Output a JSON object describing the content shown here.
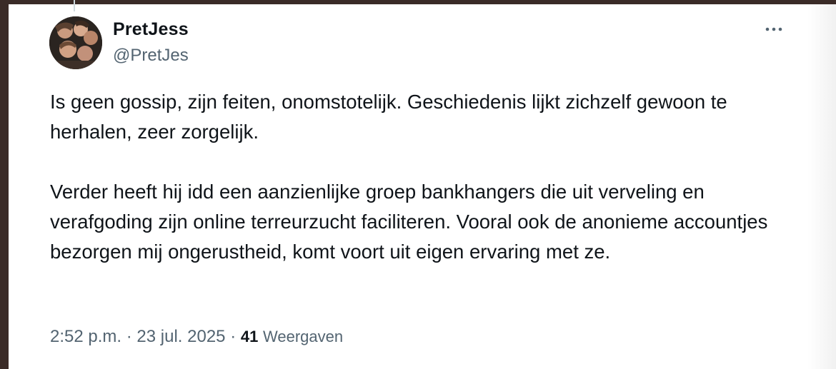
{
  "tweet": {
    "author_name": "PretJess",
    "author_handle": "@PretJes",
    "paragraphs": [
      "Is geen gossip, zijn feiten, onomstotelijk. Geschiedenis lijkt zichzelf gewoon te herhalen, zeer zorgelijk.",
      "Verder heeft hij idd een aanzienlijke groep bankhangers die uit verveling en verafgoding zijn online terreurzucht faciliteren. Vooral ook de anonieme accountjes bezorgen mij ongerustheid, komt voort uit eigen ervaring met ze."
    ],
    "time": "2:52 p.m.",
    "date": "23 jul. 2025",
    "separator": "·",
    "views_count": "41",
    "views_label": "Weergaven"
  },
  "icons": {
    "more": "more-horizontal-icon",
    "avatar": "profile-photo"
  },
  "colors": {
    "text_primary": "#0f1419",
    "text_secondary": "#536471",
    "background": "#ffffff",
    "frame": "#3a2b27"
  }
}
